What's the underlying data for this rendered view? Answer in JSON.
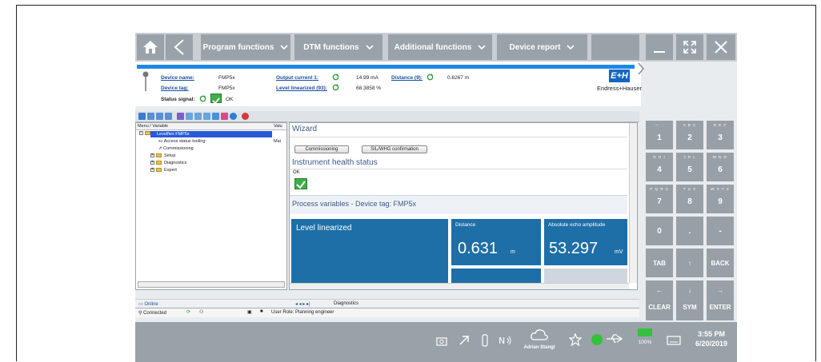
{
  "nav": {
    "program_functions": "Program functions",
    "dtm_functions": "DTM functions",
    "additional_functions": "Additional functions",
    "device_report": "Device report"
  },
  "header": {
    "device_name_label": "Device name:",
    "device_name_value": "FMP5x",
    "device_tag_label": "Device tag:",
    "device_tag_value": "FMP5x",
    "status_signal_label": "Status signal:",
    "status_signal_value": "OK",
    "output_current_label": "Output current 1:",
    "output_current_value": "14.99  mA",
    "level_linearized_label": "Level linearized (93):",
    "level_linearized_value": "68.3858  %",
    "distance_label": "Distance (9):",
    "distance_value": "0.6267  m",
    "logo_mark": "E+H",
    "brand": "Endress+Hauser"
  },
  "tree": {
    "col_menu": "Menu / Variable",
    "col_val": "Valu",
    "root": "Levelflex FMP5x",
    "items": [
      "Access status tooling:",
      "Commissioning",
      "Setup",
      "Diagnostics",
      "Expert"
    ],
    "access_value": "Mai"
  },
  "wizard": {
    "title": "Wizard",
    "commissioning_btn": "Commissioning",
    "sil_btn": "SIL/WHG confirmation",
    "health_title": "Instrument health status",
    "health_value": "OK",
    "process_title": "Process variables - Device tag: FMP5x",
    "level_tile": "Level linearized",
    "distance_tile": "Distance",
    "distance_value": "0.631",
    "distance_unit": "m",
    "echo_tile": "Absolute echo amplitude",
    "echo_value": "53.297",
    "echo_unit": "mV"
  },
  "bottom": {
    "tab_online": "Online",
    "tab_diagnostics": "Diagnostics",
    "connected": "Connected",
    "user_role": "User Role: Planning engineer"
  },
  "keypad": {
    "k1": "1",
    "k2": "2",
    "k2s": "A B C",
    "k3": "3",
    "k3s": "D E F",
    "k4": "4",
    "k4s": "G H I",
    "k5": "5",
    "k5s": "J K L",
    "k6": "6",
    "k6s": "M N O",
    "k7": "7",
    "k7s": "P Q R S",
    "k8": "8",
    "k8s": "T U V",
    "k9": "9",
    "k9s": "W X Y Z",
    "k0": "0",
    "kdot": ".",
    "kminus": "-",
    "tab": "TAB",
    "up": "↑",
    "back": "BACK",
    "left": "←",
    "down": "↓",
    "right": "→",
    "clear": "CLEAR",
    "sym": "SYM",
    "enter": "ENTER"
  },
  "taskbar": {
    "user": "Adrian Stangl",
    "battery": "100%",
    "time": "3:55 PM",
    "date": "6/20/2019"
  }
}
